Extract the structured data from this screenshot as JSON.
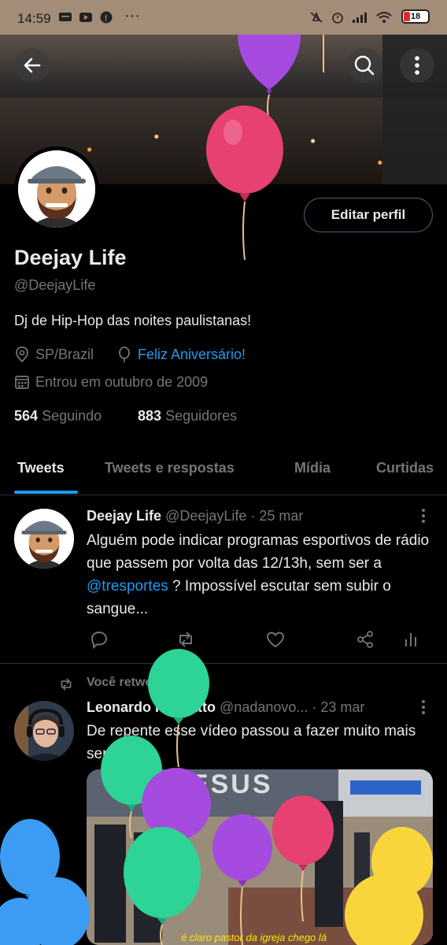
{
  "status_bar": {
    "time": "14:59",
    "battery_level": "18"
  },
  "profile": {
    "edit_button": "Editar perfil",
    "name": "Deejay Life",
    "handle": "@DeejayLife",
    "bio": "Dj de Hip-Hop das noites paulistanas!",
    "location": "SP/Brazil",
    "birthday": "Feliz Aniversário!",
    "joined": "Entrou em outubro de 2009",
    "following_count": "564",
    "following_label": "Seguindo",
    "followers_count": "883",
    "followers_label": "Seguidores"
  },
  "tabs": [
    {
      "label": "Tweets",
      "active": true
    },
    {
      "label": "Tweets e respostas",
      "active": false
    },
    {
      "label": "Mídia",
      "active": false
    },
    {
      "label": "Curtidas",
      "active": false
    }
  ],
  "tweets": [
    {
      "name": "Deejay Life",
      "handle": "@DeejayLife",
      "date": "· 25 mar",
      "body_part1": "Alguém pode indicar programas esportivos de rádio que passem por volta das 12/13h, sem ser a ",
      "mention": "@tresportes",
      "body_part2": " ? Impossível escutar sem subir o sangue..."
    },
    {
      "retweet_label": "Você retweetou",
      "name": "Leonardo Rossatto",
      "handle": "@nadanovo...",
      "date": "· 23 mar",
      "body": "De repente esse vídeo passou a fazer muito mais sentido",
      "media_title": "JESUS",
      "media_caption": "é claro pastor da igreja chego lá"
    }
  ],
  "colors": {
    "accent": "#1d9bf0",
    "background": "#000000",
    "muted": "#71767b"
  }
}
